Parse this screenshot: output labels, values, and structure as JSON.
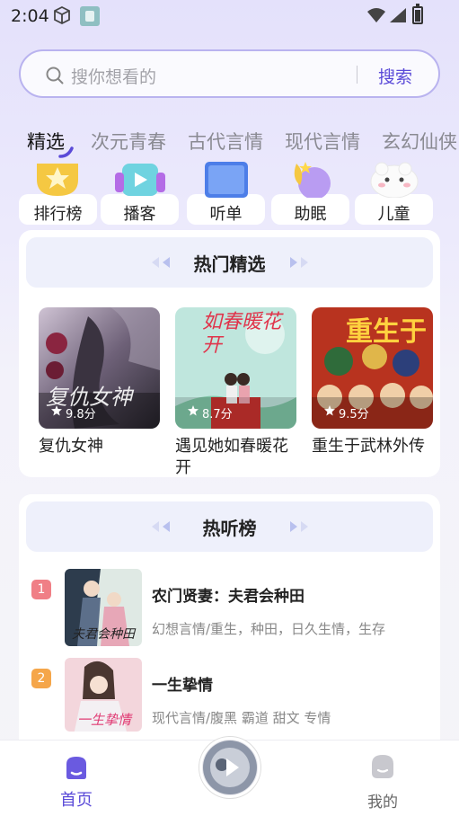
{
  "status_bar": {
    "time": "2:04"
  },
  "search": {
    "placeholder": "搜你想看的",
    "button_label": "搜索"
  },
  "tabs": [
    {
      "label": "精选",
      "active": true
    },
    {
      "label": "次元青春",
      "active": false
    },
    {
      "label": "古代言情",
      "active": false
    },
    {
      "label": "现代言情",
      "active": false
    },
    {
      "label": "玄幻仙侠",
      "active": false
    }
  ],
  "quick_links": [
    {
      "label": "排行榜",
      "icon": "trophy-star-icon"
    },
    {
      "label": "播客",
      "icon": "headphones-play-icon"
    },
    {
      "label": "听单",
      "icon": "playlist-book-icon"
    },
    {
      "label": "助眠",
      "icon": "moon-star-icon"
    },
    {
      "label": "儿童",
      "icon": "cloud-face-icon"
    }
  ],
  "hot_picks": {
    "title": "热门精选",
    "books": [
      {
        "title": "复仇女神",
        "cover_text": "复仇女神",
        "rating": "9.8分"
      },
      {
        "title": "遇见她如春暖花开",
        "cover_text": "如春暖花开",
        "rating": "8.7分"
      },
      {
        "title": "重生于武林外传",
        "cover_text": "重生于",
        "rating": "9.5分"
      }
    ]
  },
  "hot_listen": {
    "title": "热听榜",
    "items": [
      {
        "rank": "1",
        "title": "农门贤妻：夫君会种田",
        "tags": "幻想言情/重生，种田，日久生情，生存",
        "badge_color": "#f07f86"
      },
      {
        "rank": "2",
        "title": "一生挚情",
        "tags": "现代言情/腹黑 霸道 甜文 专情",
        "badge_color": "#f5a64a"
      }
    ]
  },
  "bottom_nav": {
    "home_label": "首页",
    "me_label": "我的"
  },
  "colors": {
    "accent": "#5a4ad8",
    "search_border": "#b9b3ef"
  }
}
